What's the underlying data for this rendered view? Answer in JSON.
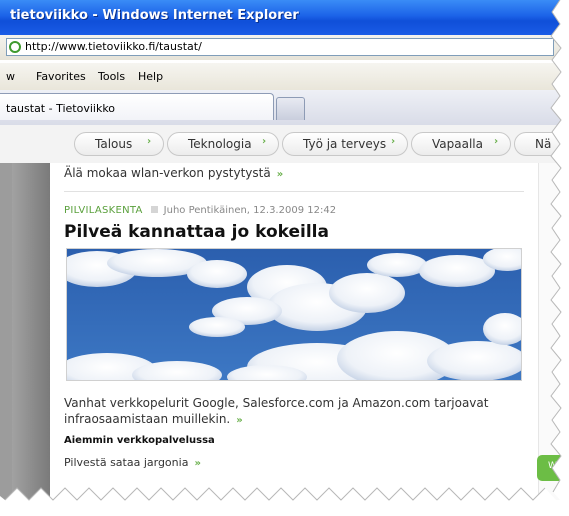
{
  "window": {
    "title": "tietoviikko - Windows Internet Explorer"
  },
  "address": {
    "url": "http://www.tietoviikko.fi/taustat/"
  },
  "menu": {
    "items": [
      "w",
      "Favorites",
      "Tools",
      "Help"
    ]
  },
  "tab": {
    "label": "taustat - Tietoviikko"
  },
  "site_nav": {
    "items": [
      "Talous",
      "Teknologia",
      "Työ ja terveys",
      "Vapaalla",
      "Nä"
    ]
  },
  "content": {
    "prev_link": "Älä mokaa wlan-verkon pystytystä",
    "article": {
      "category": "PILVILASKENTA",
      "author_date": "Juho Pentikäinen, 12.3.2009 12:42",
      "title": "Pilveä kannattaa jo kokeilla",
      "lede": "Vanhat verkkopelurit Google, Salesforce.com ja Amazon.com tarjoavat infraosaamistaan muillekin.",
      "related_heading": "Aiemmin verkkopalvelussa",
      "related_link": "Pilvestä sataa jargonia"
    },
    "more_arrow": "»"
  },
  "sidebar": {
    "pill_text": "W"
  },
  "colors": {
    "titlebar": "#1c63e8",
    "accent_green": "#6ab04c",
    "category_green": "#5aa03c",
    "sky_blue": "#2f63b0"
  }
}
